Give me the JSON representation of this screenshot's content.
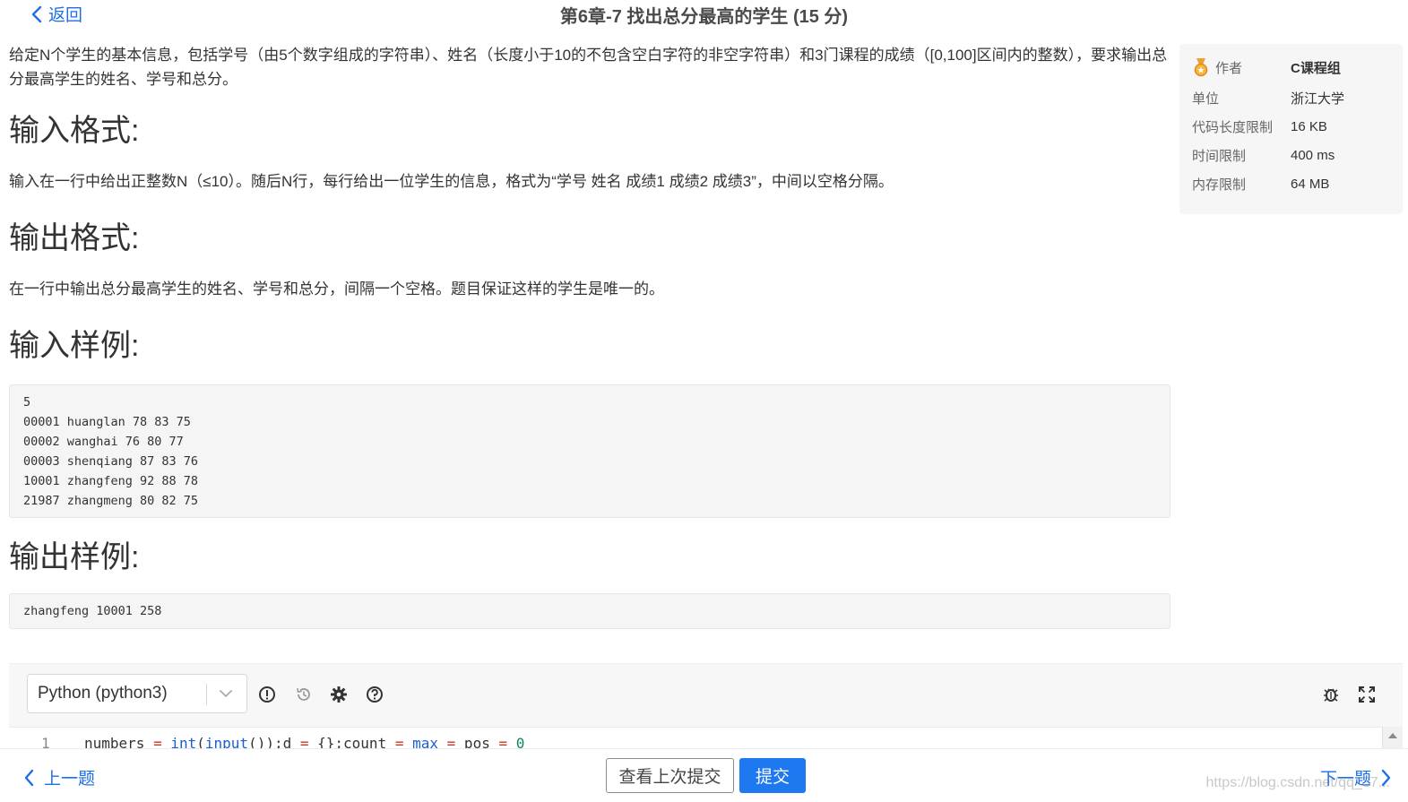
{
  "header": {
    "back_label": "返回",
    "title": "第6章-7 找出总分最高的学生 (15 分)"
  },
  "problem": {
    "description": "给定N个学生的基本信息，包括学号（由5个数字组成的字符串）、姓名（长度小于10的不包含空白字符的非空字符串）和3门课程的成绩（[0,100]区间内的整数），要求输出总分最高学生的姓名、学号和总分。",
    "input_heading": "输入格式:",
    "input_text": "输入在一行中给出正整数N（≤10）。随后N行，每行给出一位学生的信息，格式为“学号 姓名 成绩1 成绩2 成绩3”，中间以空格分隔。",
    "output_heading": "输出格式:",
    "output_text": "在一行中输出总分最高学生的姓名、学号和总分，间隔一个空格。题目保证这样的学生是唯一的。",
    "sample_input_heading": "输入样例:",
    "sample_input": "5\n00001 huanglan 78 83 75\n00002 wanghai 76 80 77\n00003 shenqiang 87 83 76\n10001 zhangfeng 92 88 78\n21987 zhangmeng 80 82 75",
    "sample_output_heading": "输出样例:",
    "sample_output": "zhangfeng 10001 258"
  },
  "info": {
    "author_label": "作者",
    "author": "C课程组",
    "unit_label": "单位",
    "unit": "浙江大学",
    "code_limit_label": "代码长度限制",
    "code_limit": "16 KB",
    "time_limit_label": "时间限制",
    "time_limit": "400 ms",
    "memory_limit_label": "内存限制",
    "memory_limit": "64 MB"
  },
  "editor": {
    "language": "Python (python3)",
    "line_number": "1",
    "code_tokens": {
      "t1": "numbers ",
      "t2": "=",
      "t3": " ",
      "t4": "int",
      "t5": "(",
      "t6": "input",
      "t7": "());d ",
      "t8": "=",
      "t9": " {};count ",
      "t10": "=",
      "t11": " ",
      "t12": "max",
      "t13": " ",
      "t14": "=",
      "t15": " pos ",
      "t16": "=",
      "t17": " ",
      "t18": "0"
    },
    "icons": [
      "info-icon",
      "history-icon",
      "gear-icon",
      "help-icon",
      "debug-icon",
      "fullscreen-icon"
    ]
  },
  "footer": {
    "prev_label": "上一题",
    "last_submission_label": "查看上次提交",
    "submit_label": "提交",
    "next_label": "下一题",
    "watermark": "https://blog.csdn.net/qq_37..."
  },
  "colors": {
    "accent": "#1e78f0",
    "link": "#1e6fe6",
    "panel_bg": "#f6f6f6"
  }
}
